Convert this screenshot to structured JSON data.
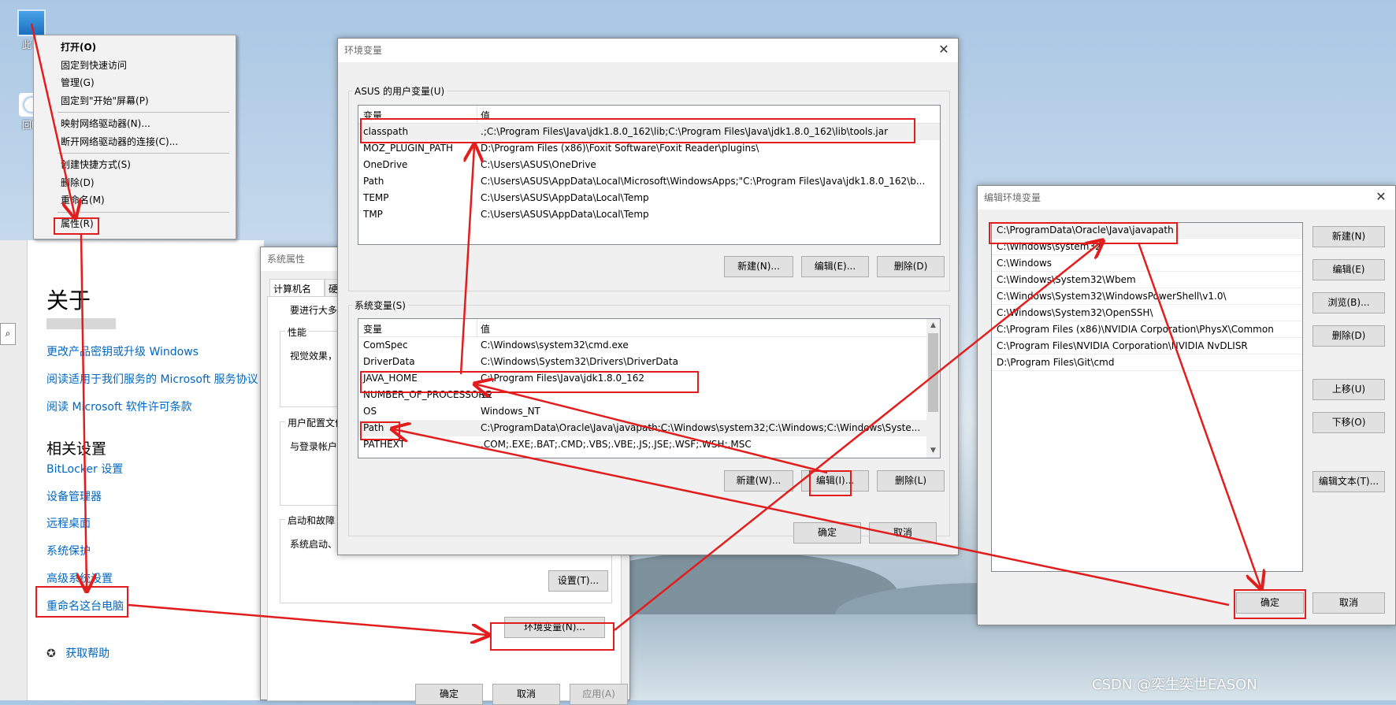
{
  "desktop": {
    "icons": [
      {
        "label": "此电"
      },
      {
        "label": "回收"
      }
    ]
  },
  "context_menu": {
    "items": [
      {
        "label": "打开(O)",
        "bold": true
      },
      {
        "label": "固定到快速访问"
      },
      {
        "label": "管理(G)"
      },
      {
        "label": "固定到\"开始\"屏幕(P)"
      },
      {
        "sep": true
      },
      {
        "label": "映射网络驱动器(N)..."
      },
      {
        "label": "断开网络驱动器的连接(C)..."
      },
      {
        "sep": true
      },
      {
        "label": "创建快捷方式(S)"
      },
      {
        "label": "删除(D)"
      },
      {
        "label": "重命名(M)"
      },
      {
        "sep": true
      },
      {
        "label": "属性(R)"
      }
    ]
  },
  "settings": {
    "title": "关于",
    "links1": [
      "更改产品密钥或升级 Windows",
      "阅读适用于我们服务的 Microsoft 服务协议",
      "阅读 Microsoft 软件许可条款"
    ],
    "related_title": "相关设置",
    "links2": [
      "BitLocker 设置",
      "设备管理器",
      "远程桌面",
      "系统保护",
      "高级系统设置",
      "重命名这台电脑"
    ],
    "help": "获取帮助"
  },
  "sys_props": {
    "title": "系统属性",
    "tabs": [
      "计算机名",
      "硬件"
    ],
    "intro": "要进行大多数",
    "perf_label": "性能",
    "perf_text": "视觉效果，",
    "profile_label": "用户配置文件",
    "profile_text": "与登录帐户",
    "startup_label": "启动和故障",
    "startup_text": "系统启动、",
    "settings_btn": "设置(T)...",
    "env_btn": "环境变量(N)...",
    "ok": "确定",
    "cancel": "取消",
    "apply": "应用(A)"
  },
  "env_vars": {
    "title": "环境变量",
    "user_group": "ASUS 的用户变量(U)",
    "sys_group": "系统变量(S)",
    "col_var": "变量",
    "col_val": "值",
    "user_rows": [
      {
        "name": "classpath",
        "value": ".;C:\\Program Files\\Java\\jdk1.8.0_162\\lib;C:\\Program Files\\Java\\jdk1.8.0_162\\lib\\tools.jar"
      },
      {
        "name": "MOZ_PLUGIN_PATH",
        "value": "D:\\Program Files (x86)\\Foxit Software\\Foxit Reader\\plugins\\"
      },
      {
        "name": "OneDrive",
        "value": "C:\\Users\\ASUS\\OneDrive"
      },
      {
        "name": "Path",
        "value": "C:\\Users\\ASUS\\AppData\\Local\\Microsoft\\WindowsApps;\"C:\\Program Files\\Java\\jdk1.8.0_162\\b..."
      },
      {
        "name": "TEMP",
        "value": "C:\\Users\\ASUS\\AppData\\Local\\Temp"
      },
      {
        "name": "TMP",
        "value": "C:\\Users\\ASUS\\AppData\\Local\\Temp"
      }
    ],
    "sys_rows": [
      {
        "name": "ComSpec",
        "value": "C:\\Windows\\system32\\cmd.exe"
      },
      {
        "name": "DriverData",
        "value": "C:\\Windows\\System32\\Drivers\\DriverData"
      },
      {
        "name": "JAVA_HOME",
        "value": "C:\\Program Files\\Java\\jdk1.8.0_162"
      },
      {
        "name": "NUMBER_OF_PROCESSORS",
        "value": "12"
      },
      {
        "name": "OS",
        "value": "Windows_NT"
      },
      {
        "name": "Path",
        "value": "C:\\ProgramData\\Oracle\\Java\\javapath;C:\\Windows\\system32;C:\\Windows;C:\\Windows\\Syste..."
      },
      {
        "name": "PATHEXT",
        "value": ".COM;.EXE;.BAT;.CMD;.VBS;.VBE;.JS;.JSE;.WSF;.WSH;.MSC"
      }
    ],
    "user_btns": [
      "新建(N)...",
      "编辑(E)...",
      "删除(D)"
    ],
    "sys_btns": [
      "新建(W)...",
      "编辑(I)...",
      "删除(L)"
    ],
    "ok": "确定",
    "cancel": "取消"
  },
  "edit_env": {
    "title": "编辑环境变量",
    "entries": [
      "C:\\ProgramData\\Oracle\\Java\\javapath",
      "C:\\Windows\\system32",
      "C:\\Windows",
      "C:\\Windows\\System32\\Wbem",
      "C:\\Windows\\System32\\WindowsPowerShell\\v1.0\\",
      "C:\\Windows\\System32\\OpenSSH\\",
      "C:\\Program Files (x86)\\NVIDIA Corporation\\PhysX\\Common",
      "C:\\Program Files\\NVIDIA Corporation\\NVIDIA NvDLISR",
      "D:\\Program Files\\Git\\cmd"
    ],
    "buttons": [
      "新建(N)",
      "编辑(E)",
      "浏览(B)...",
      "删除(D)",
      "上移(U)",
      "下移(O)",
      "编辑文本(T)..."
    ],
    "ok": "确定",
    "cancel": "取消"
  },
  "watermark": "CSDN @奕生奕世EASON"
}
